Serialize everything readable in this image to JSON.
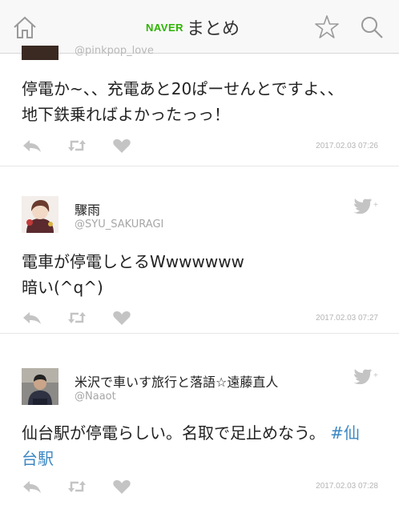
{
  "header": {
    "logo_naver": "NAVER",
    "logo_matome": "まとめ",
    "home_icon": "home-icon",
    "favorite_icon": "star-outline-icon",
    "search_icon": "search-icon"
  },
  "tweets": [
    {
      "handle": "@pinkpop_love",
      "text_lines": [
        "停電か~、、充電あと20ぱーせんとですよ、、",
        "地下鉄乗ればよかったっっ！"
      ],
      "timestamp": "2017.02.03 07:26"
    },
    {
      "name": "驟雨",
      "handle": "@SYU_SAKURAGI",
      "text_lines": [
        "電車が停電しとるWwwwwww",
        "暗い(^q^)"
      ],
      "timestamp": "2017.02.03 07:27"
    },
    {
      "name": "米沢で車いす旅行と落語☆遠藤直人",
      "handle": "@Naaot",
      "text_line1": "仙台駅が停電らしい。名取で足止めなう。",
      "hashtag_part1": "#仙",
      "hashtag_part2": "台駅",
      "timestamp": "2017.02.03 07:28"
    }
  ],
  "icons": {
    "reply": "reply-icon",
    "retweet": "retweet-icon",
    "like": "heart-icon",
    "follow": "twitter-follow-icon"
  },
  "colors": {
    "brand_green": "#2db400",
    "hashtag_blue": "#3b88c3",
    "icon_gray": "#c4c4c4"
  }
}
